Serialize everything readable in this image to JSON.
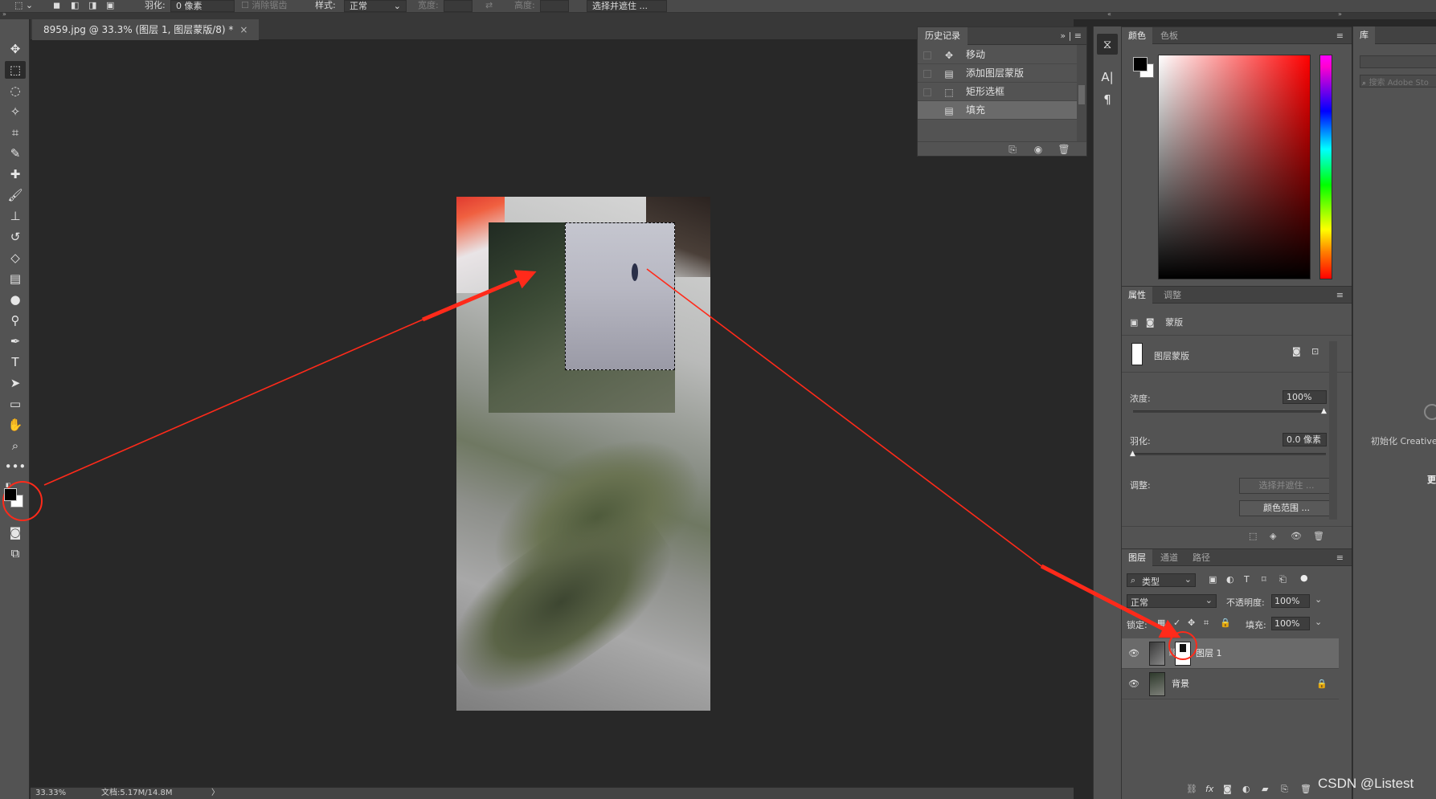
{
  "options_bar": {
    "feather_label": "羽化:",
    "feather_value": "0 像素",
    "antialias_label": "消除锯齿",
    "style_label": "样式:",
    "style_value": "正常",
    "width_label": "宽度:",
    "height_label": "高度:",
    "select_mask_button": "选择并遮住 ..."
  },
  "document_tab": {
    "title": "8959.jpg @ 33.3% (图层 1, 图层蒙版/8) *",
    "close": "×"
  },
  "status_bar": {
    "zoom": "33.33%",
    "doc_info": "文档:5.17M/14.8M",
    "arrow": "〉"
  },
  "history_panel": {
    "tab": "历史记录",
    "items": [
      {
        "icon": "move-icon",
        "label": "移动"
      },
      {
        "icon": "mask-icon",
        "label": "添加图层蒙版"
      },
      {
        "icon": "marquee-icon",
        "label": "矩形选框"
      },
      {
        "icon": "fill-icon",
        "label": "填充"
      }
    ]
  },
  "color_panel": {
    "tabs": [
      "颜色",
      "色板"
    ],
    "foreground": "#000000",
    "background": "#ffffff"
  },
  "properties_panel": {
    "tabs": [
      "属性",
      "调整"
    ],
    "type_label": "蒙版",
    "mask_label": "图层蒙版",
    "density_label": "浓度:",
    "density_value": "100%",
    "feather_label": "羽化:",
    "feather_value": "0.0 像素",
    "adjust_label": "调整:",
    "select_mask_button": "选择并遮住 ...",
    "color_range_button": "颜色范围 ..."
  },
  "layers_panel": {
    "tabs": [
      "图层",
      "通道",
      "路径"
    ],
    "filter_kind": "类型",
    "blend_mode": "正常",
    "opacity_label": "不透明度:",
    "opacity_value": "100%",
    "lock_label": "锁定:",
    "fill_label": "填充:",
    "fill_value": "100%",
    "layers": [
      {
        "name": "图层 1",
        "selected": true,
        "has_mask": true
      },
      {
        "name": "背景",
        "selected": false,
        "locked": true
      }
    ]
  },
  "library_panel": {
    "tab": "库",
    "search_placeholder": "搜索 Adobe Sto",
    "init_text": "初始化 Creative",
    "side_text": "更"
  },
  "watermark": "CSDN @Listest",
  "annotation_color": "#ff2a1a"
}
